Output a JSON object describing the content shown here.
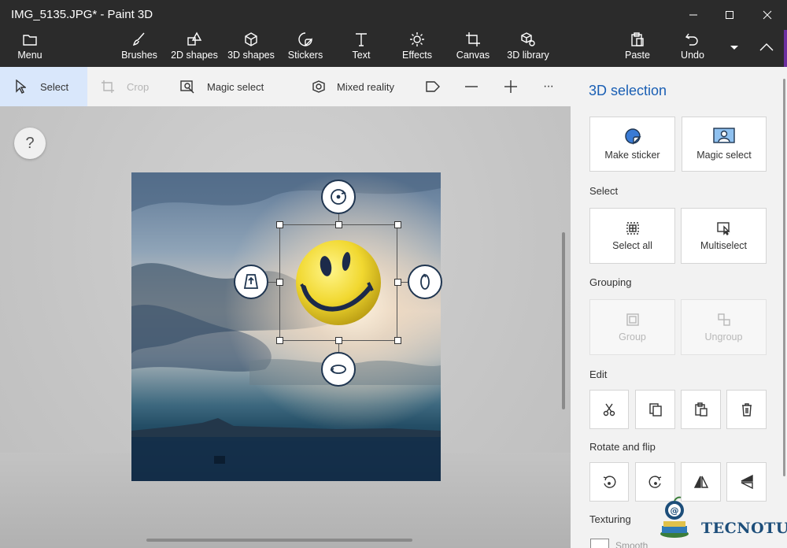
{
  "window": {
    "title": "IMG_5135.JPG* - Paint 3D"
  },
  "commandbar": {
    "menu": "Menu",
    "brushes": "Brushes",
    "shapes2d": "2D shapes",
    "shapes3d": "3D shapes",
    "stickers": "Stickers",
    "text": "Text",
    "effects": "Effects",
    "canvas": "Canvas",
    "library3d": "3D library",
    "paste": "Paste",
    "undo": "Undo"
  },
  "toolbar": {
    "select": "Select",
    "crop": "Crop",
    "magic_select": "Magic select",
    "mixed_reality": "Mixed reality",
    "more": "···"
  },
  "canvas": {
    "help": "?"
  },
  "panel": {
    "title": "3D selection",
    "make_sticker": "Make sticker",
    "magic_select": "Magic select",
    "select_label": "Select",
    "select_all": "Select all",
    "multiselect": "Multiselect",
    "grouping_label": "Grouping",
    "group": "Group",
    "ungroup": "Ungroup",
    "edit_label": "Edit",
    "rotate_flip_label": "Rotate and flip",
    "texturing_label": "Texturing",
    "smooth": "Smooth"
  },
  "watermark": {
    "text": "TECNOTUTO"
  },
  "colors": {
    "accent": "#1a5fb4",
    "titlebar": "#2b2b2b",
    "selected_tool": "#d9e7fb"
  }
}
